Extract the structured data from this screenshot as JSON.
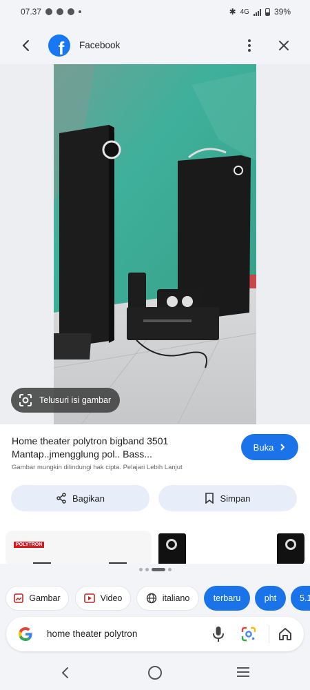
{
  "status_bar": {
    "time": "07.37",
    "network": "4G",
    "battery": "39%"
  },
  "topbar": {
    "title": "Facebook",
    "logo_letter": "f"
  },
  "image_viewer": {
    "lens_label": "Telusuri isi gambar"
  },
  "result": {
    "title_line1": "Home theater polytron bigband 3501",
    "title_line2": "Mantap..jmengglung pol.. Bass...",
    "open_label": "Buka",
    "copyright_note": "Gambar mungkin dilindungi hak cipta. Pelajari Lebih Lanjut",
    "share_label": "Bagikan",
    "save_label": "Simpan"
  },
  "related": {
    "brand_label": "POLYTRON"
  },
  "chips": [
    {
      "label": "Gambar",
      "icon": "image-icon"
    },
    {
      "label": "Video",
      "icon": "video-icon"
    },
    {
      "label": "italiano",
      "icon": "globe-icon"
    },
    {
      "label": "terbaru"
    },
    {
      "label": "pht"
    },
    {
      "label": "5.1"
    }
  ],
  "search": {
    "query": "home theater polytron"
  },
  "colors": {
    "accent": "#1a73e8",
    "facebook": "#1877f2",
    "wall": "#3fb09b"
  }
}
